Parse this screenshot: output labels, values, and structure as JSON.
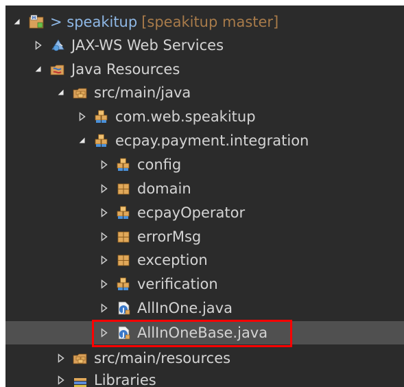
{
  "project": {
    "label": "> speakitup",
    "branch": "[speakitup master]"
  },
  "tree": {
    "jaxws": "JAX-WS Web Services",
    "java_resources": "Java Resources",
    "src_main_java": "src/main/java",
    "pkg_web": "com.web.speakitup",
    "pkg_ecpay": "ecpay.payment.integration",
    "config": "config",
    "domain": "domain",
    "ecpay_operator": "ecpayOperator",
    "error_msg": "errorMsg",
    "exception": "exception",
    "verification": "verification",
    "allinone": "AllInOne.java",
    "allinonebase": "AllInOneBase.java",
    "src_main_resources": "src/main/resources",
    "libraries": "Libraries"
  },
  "icons": {
    "expanded": "triangle-down-icon",
    "collapsed": "triangle-right-icon",
    "project": "project-icon",
    "webservice": "webservice-icon",
    "java_resources": "java-resources-icon",
    "source_folder": "source-folder-icon",
    "package": "package-icon",
    "empty_package": "empty-package-icon",
    "java_file": "java-file-icon",
    "library": "library-icon"
  },
  "colors": {
    "background": "#2b2b2b",
    "text": "#d4d4d4",
    "project_text": "#8fb8e6",
    "branch_text": "#a87b4a",
    "selection": "#505050",
    "highlight": "#ff0000"
  }
}
